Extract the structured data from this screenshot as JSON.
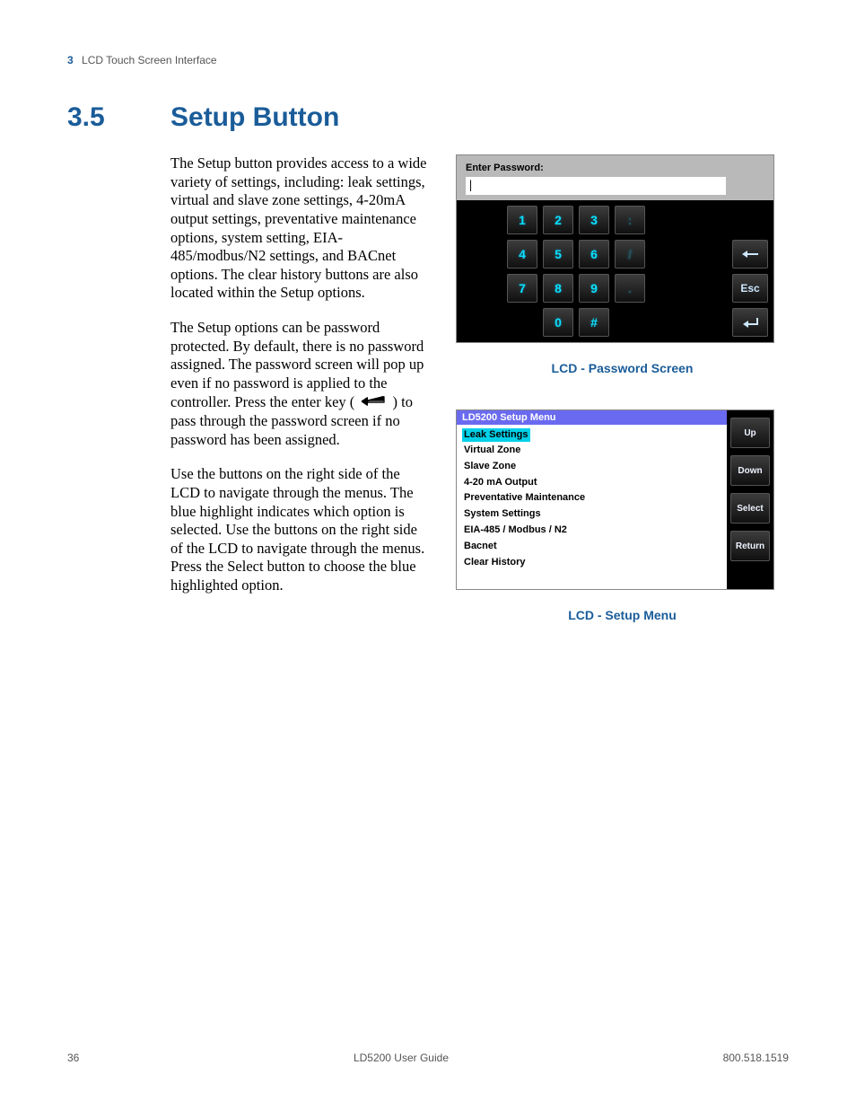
{
  "header": {
    "chapter_number": "3",
    "chapter_title": "LCD Touch Screen Interface"
  },
  "section": {
    "number": "3.5",
    "title": "Setup Button"
  },
  "body": {
    "p1": "The Setup button provides access to a wide variety of settings, including: leak settings, virtual and slave zone settings, 4-20mA output settings, preventative maintenance options, system setting, EIA-485/modbus/N2 settings, and BACnet options. The clear history buttons are also located within the Setup options.",
    "p2a": "The Setup options can be password protected. By default, there is no password assigned. The password screen will pop up even if no password is applied to the controller. Press the enter key (",
    "p2b": ") to pass through the password screen if no password has been assigned.",
    "p3": "Use the buttons on the right side of the LCD to navigate through the menus. The blue highlight indicates which option is selected. Use the buttons on the right side of the LCD to navigate through the menus. Press the Select button to choose the blue highlighted option."
  },
  "figures": {
    "password": {
      "prompt": "Enter Password:",
      "cursor": "|",
      "keys": [
        "1",
        "2",
        "3",
        ":",
        "4",
        "5",
        "6",
        "/",
        "7",
        "8",
        "9",
        ".",
        "",
        "0",
        "#",
        ""
      ],
      "side": {
        "esc": "Esc"
      },
      "caption": "LCD - Password Screen"
    },
    "setup": {
      "header": "LD5200 Setup Menu",
      "items": [
        "Leak Settings",
        "Virtual Zone",
        "Slave Zone",
        "4-20 mA Output",
        "Preventative Maintenance",
        "System Settings",
        "EIA-485 / Modbus / N2",
        "Bacnet",
        "Clear History"
      ],
      "selected_index": 0,
      "nav": {
        "up": "Up",
        "down": "Down",
        "select": "Select",
        "return": "Return"
      },
      "caption": "LCD - Setup Menu"
    }
  },
  "footer": {
    "page": "36",
    "doc": "LD5200 User Guide",
    "phone": "800.518.1519"
  }
}
